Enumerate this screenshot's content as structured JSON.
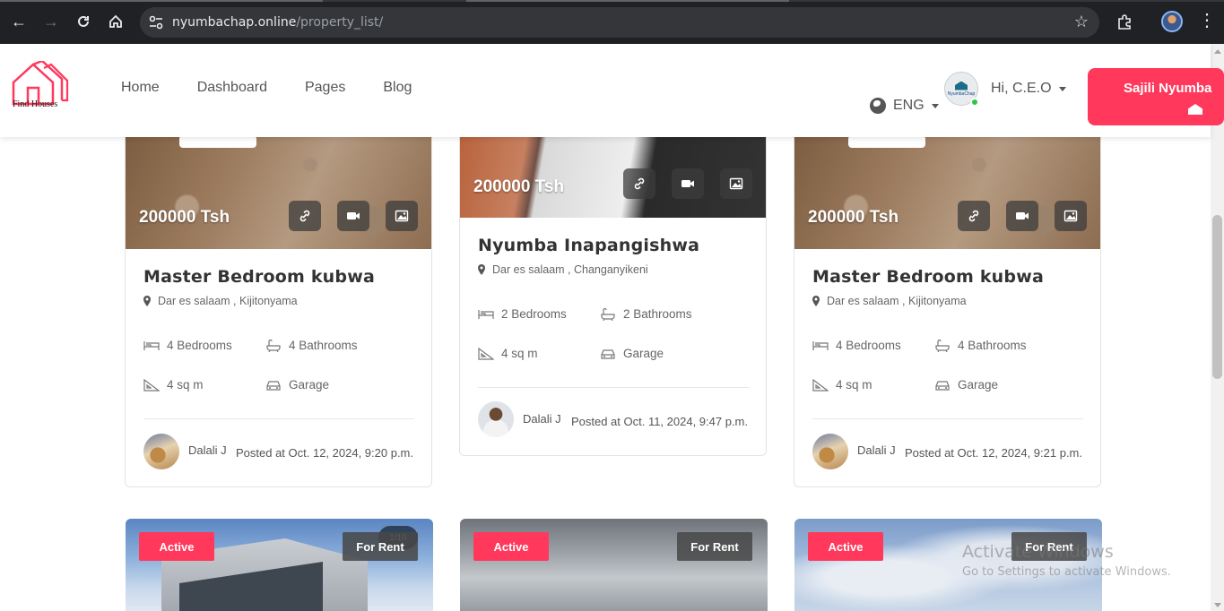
{
  "browser": {
    "url_host": "nyumbachap.online",
    "url_path": "/property_list/"
  },
  "header": {
    "logo_text": "Find Houses",
    "nav": [
      "Home",
      "Dashboard",
      "Pages",
      "Blog"
    ],
    "language": "ENG",
    "greeting": "Hi, C.E.O",
    "avatar_text": "NyumbaChap",
    "cta_label": "Sajili Nyumba"
  },
  "labels": {
    "bedrooms_suffix": "Bedrooms",
    "bathrooms_suffix": "Bathrooms"
  },
  "listings": [
    {
      "price": "200000 Tsh",
      "title": "Master Bedroom kubwa",
      "location": "Dar es salaam , Kijitonyama",
      "bedrooms": "4 Bedrooms",
      "bathrooms": "4 Bathrooms",
      "area": "4 sq m",
      "garage": "Garage",
      "agent": "Dalali J",
      "posted": "Posted at Oct. 12, 2024, 9:20 p.m."
    },
    {
      "price": "200000 Tsh",
      "title": "Nyumba Inapangishwa",
      "location": "Dar es salaam , Changanyikeni",
      "bedrooms": "2 Bedrooms",
      "bathrooms": "2 Bathrooms",
      "area": "4 sq m",
      "garage": "Garage",
      "agent": "Dalali J",
      "posted": "Posted at Oct. 11, 2024, 9:47 p.m."
    },
    {
      "price": "200000 Tsh",
      "title": "Master Bedroom kubwa",
      "location": "Dar es salaam , Kijitonyama",
      "bedrooms": "4 Bedrooms",
      "bathrooms": "4 Bathrooms",
      "area": "4 sq m",
      "garage": "Garage",
      "agent": "Dalali J",
      "posted": "Posted at Oct. 12, 2024, 9:21 p.m."
    }
  ],
  "bottom_cards": [
    {
      "status": "Active",
      "type": "For Rent",
      "counter": "1/10"
    },
    {
      "status": "Active",
      "type": "For Rent"
    },
    {
      "status": "Active",
      "type": "For Rent"
    }
  ],
  "watermark": {
    "line1": "Activate Windows",
    "line2": "Go to Settings to activate Windows."
  },
  "colors": {
    "accent": "#ff385c",
    "chrome_bg": "#202124"
  }
}
